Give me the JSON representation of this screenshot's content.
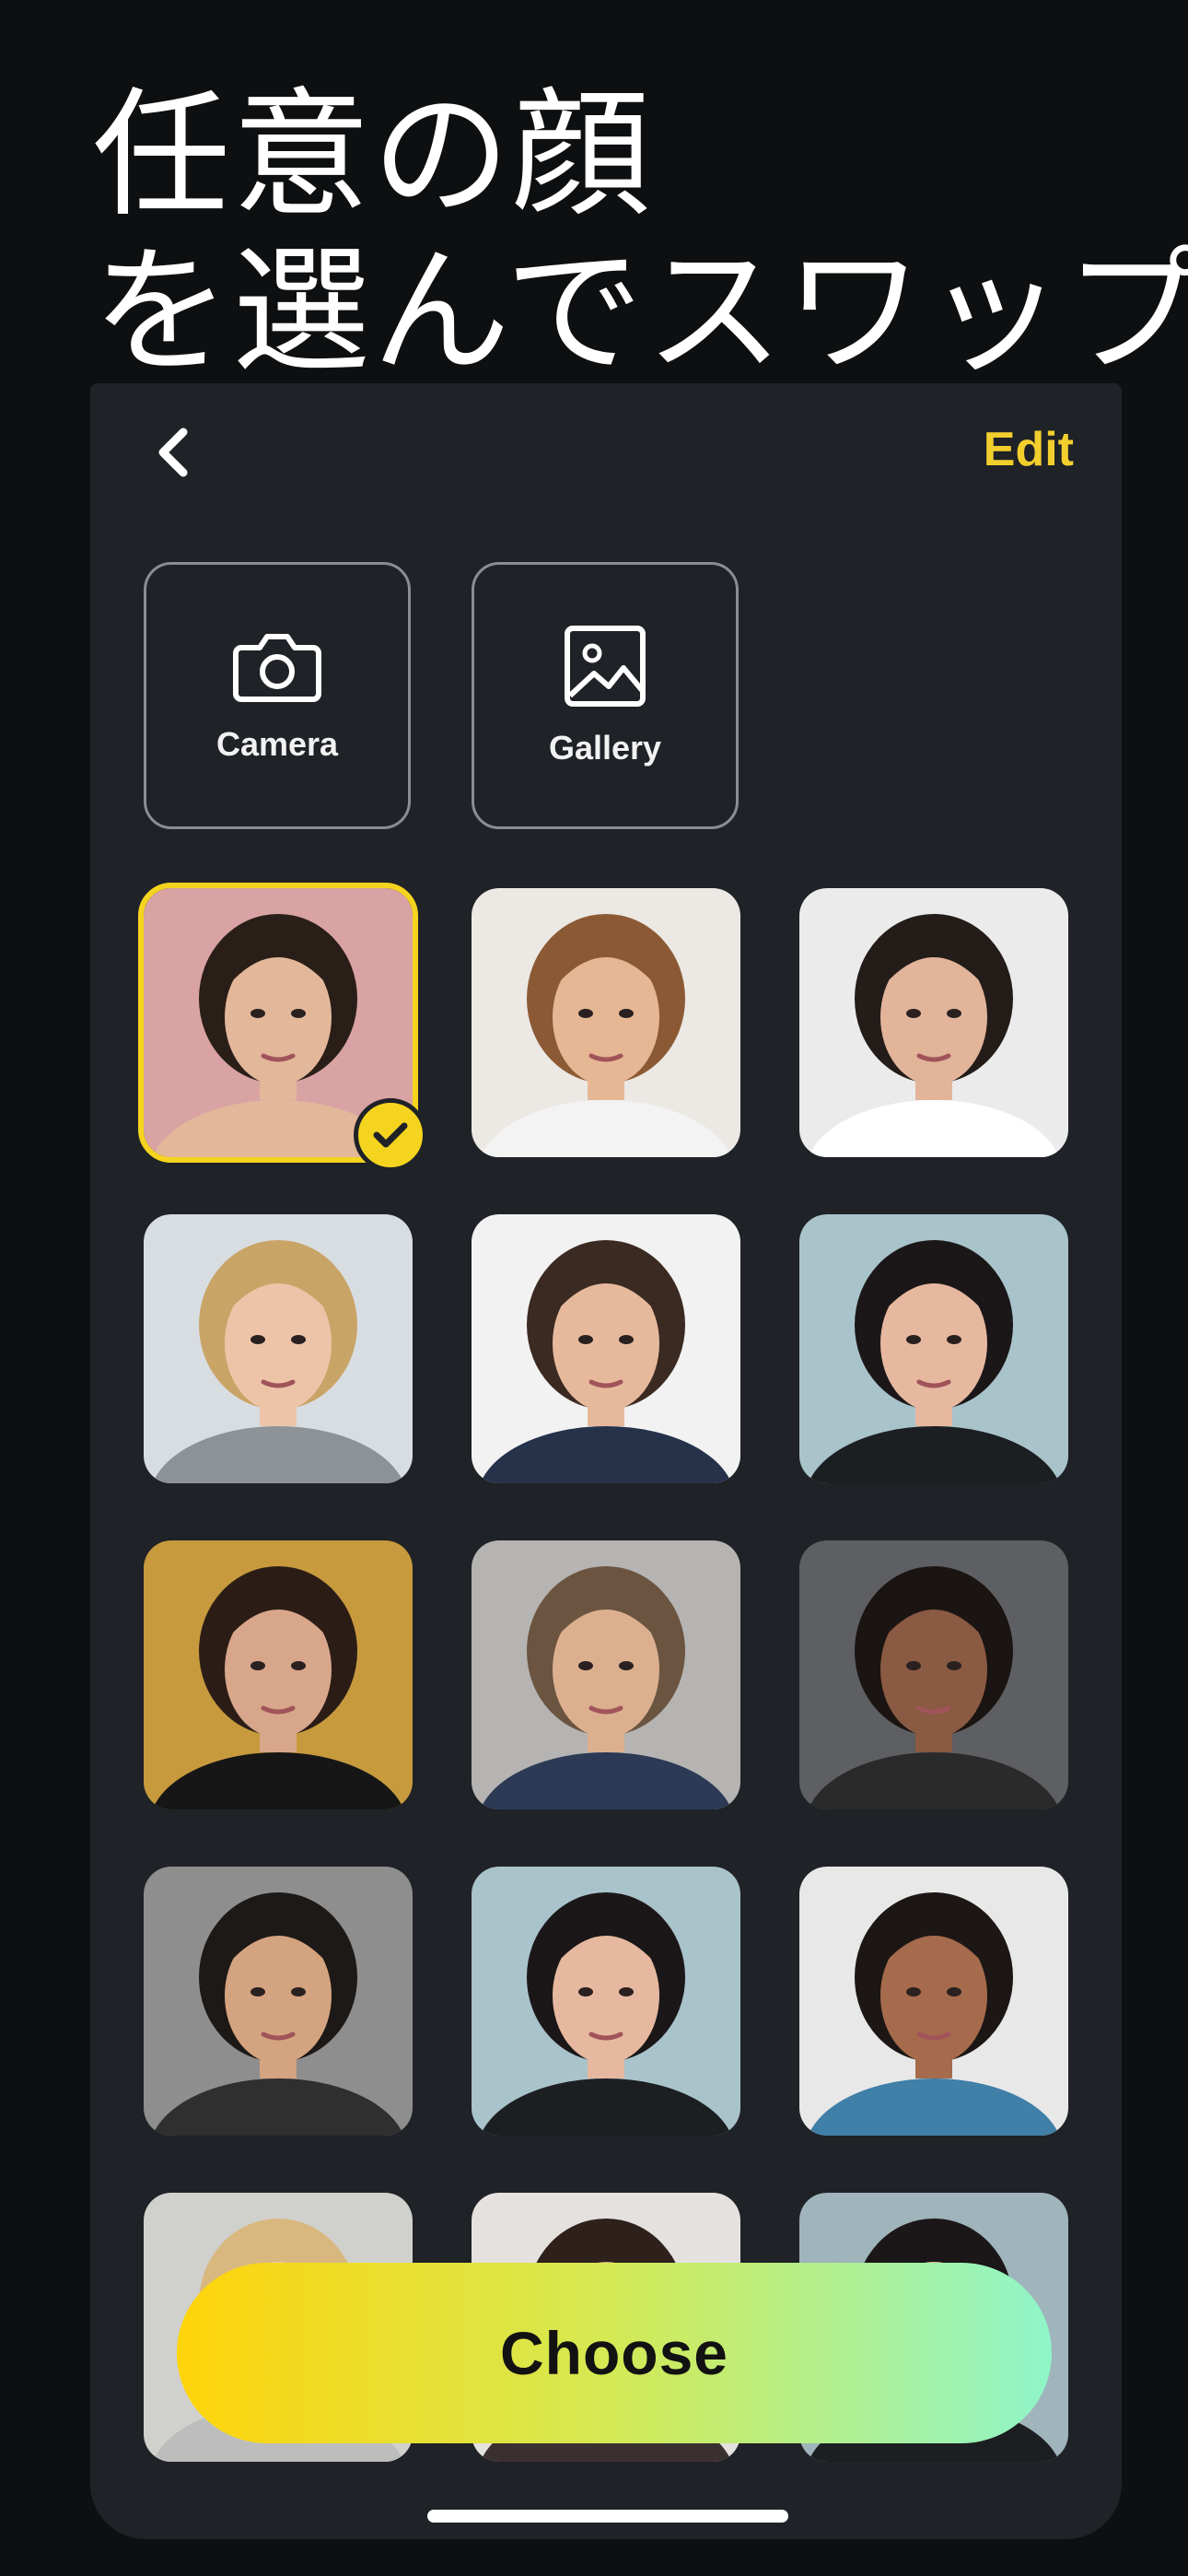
{
  "headline": {
    "line1": "任意の顔",
    "line2": "を選んでスワップ"
  },
  "header": {
    "back_icon": "chevron-left-icon",
    "edit_label": "Edit",
    "accent_color": "#f3cf2e"
  },
  "sources": [
    {
      "label": "Camera",
      "icon": "camera-icon"
    },
    {
      "label": "Gallery",
      "icon": "image-icon"
    }
  ],
  "faces": [
    {
      "name": "face-1",
      "selected": true,
      "bg": "#d9a3a3",
      "skin": "#e3b79a",
      "hair": "#2a1e18",
      "shirt": "#e3b79a"
    },
    {
      "name": "face-2",
      "selected": false,
      "bg": "#ece8e4",
      "skin": "#e6b794",
      "hair": "#8b5a34",
      "shirt": "#f3f3f3"
    },
    {
      "name": "face-3",
      "selected": false,
      "bg": "#ebebeb",
      "skin": "#e2b49a",
      "hair": "#231c19",
      "shirt": "#ffffff"
    },
    {
      "name": "face-4",
      "selected": false,
      "bg": "#d8dde2",
      "skin": "#edc4a8",
      "hair": "#c9a467",
      "shirt": "#8d9297"
    },
    {
      "name": "face-5",
      "selected": false,
      "bg": "#f2f2f2",
      "skin": "#e7b99c",
      "hair": "#3b2a22",
      "shirt": "#25324a"
    },
    {
      "name": "face-6",
      "selected": false,
      "bg": "#a9c3cb",
      "skin": "#e6b89f",
      "hair": "#1b1718",
      "shirt": "#1c1f22"
    },
    {
      "name": "face-7",
      "selected": false,
      "bg": "#c79a3e",
      "skin": "#d8a68a",
      "hair": "#2b1d16",
      "shirt": "#161616"
    },
    {
      "name": "face-8",
      "selected": false,
      "bg": "#b5b4b2",
      "skin": "#dcb08f",
      "hair": "#6b5440",
      "shirt": "#2c3a55"
    },
    {
      "name": "face-9",
      "selected": false,
      "bg": "#5e5f62",
      "skin": "#8a5a42",
      "hair": "#1a1412",
      "shirt": "#2a2a2a"
    },
    {
      "name": "face-10",
      "selected": false,
      "bg": "#8e8e8e",
      "skin": "#d4a37f",
      "hair": "#1d1917",
      "shirt": "#2f2f2f"
    },
    {
      "name": "face-11",
      "selected": false,
      "bg": "#a9c3cb",
      "skin": "#e6b89f",
      "hair": "#1b1718",
      "shirt": "#1c1f22"
    },
    {
      "name": "face-12",
      "selected": false,
      "bg": "#e8e8e8",
      "skin": "#a56b4c",
      "hair": "#1c1714",
      "shirt": "#3f7fa8"
    },
    {
      "name": "face-13",
      "selected": false,
      "bg": "#d0d0cd",
      "skin": "#edc9ad",
      "hair": "#d9b880",
      "shirt": "#bdbdbd"
    },
    {
      "name": "face-14",
      "selected": false,
      "bg": "#e4e1de",
      "skin": "#d9a98a",
      "hair": "#2e201b",
      "shirt": "#3a3030"
    },
    {
      "name": "face-15",
      "selected": false,
      "bg": "#9fb4bb",
      "skin": "#e6b89f",
      "hair": "#1b1718",
      "shirt": "#1c1f22"
    }
  ],
  "choose_button": {
    "label": "Choose",
    "gradient": [
      "#ffd40a",
      "#d4ea55",
      "#8ff5c9"
    ]
  }
}
